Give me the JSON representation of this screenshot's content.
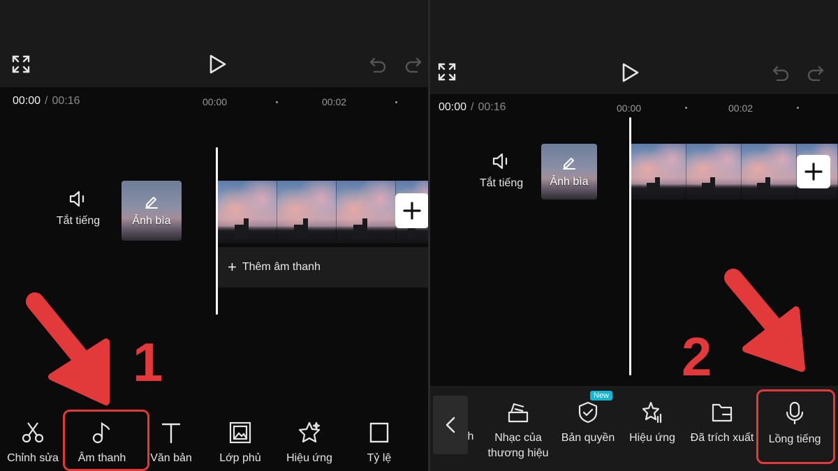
{
  "left": {
    "timecode": {
      "current": "00:00",
      "separator": "/",
      "duration": "00:16"
    },
    "ruler": [
      "00:00",
      "00:02"
    ],
    "mute_label": "Tắt tiếng",
    "cover_label": "Ảnh bìa",
    "add_audio_label": "Thêm âm thanh",
    "toolbar": [
      {
        "label": "Chỉnh sửa",
        "icon": "scissors-icon"
      },
      {
        "label": "Âm thanh",
        "icon": "music-note-icon"
      },
      {
        "label": "Văn bản",
        "icon": "text-icon"
      },
      {
        "label": "Lớp phủ",
        "icon": "overlay-icon"
      },
      {
        "label": "Hiệu ứng",
        "icon": "effects-star-icon"
      },
      {
        "label": "Tỷ lệ",
        "icon": "ratio-icon"
      }
    ],
    "step": "1"
  },
  "right": {
    "timecode": {
      "current": "00:00",
      "separator": "/",
      "duration": "00:16"
    },
    "ruler": [
      "00:00",
      "00:02"
    ],
    "mute_label": "Tắt tiếng",
    "cover_label": "Ảnh bìa",
    "toolbar": [
      {
        "label": "h",
        "icon": ""
      },
      {
        "label": "Nhạc của\nthương hiệu",
        "icon": "brand-music-icon"
      },
      {
        "label": "Bản quyền",
        "icon": "shield-check-icon",
        "badge": "New"
      },
      {
        "label": "Hiệu ứng",
        "icon": "sound-effects-icon"
      },
      {
        "label": "Đã trích xuất",
        "icon": "folder-icon"
      },
      {
        "label": "Lồng tiếng",
        "icon": "microphone-icon"
      }
    ],
    "step": "2"
  },
  "colors": {
    "accent_red": "#e2393b",
    "badge_blue": "#16b5d1",
    "background": "#0b0b0b",
    "topbar": "#1a1a1a"
  }
}
